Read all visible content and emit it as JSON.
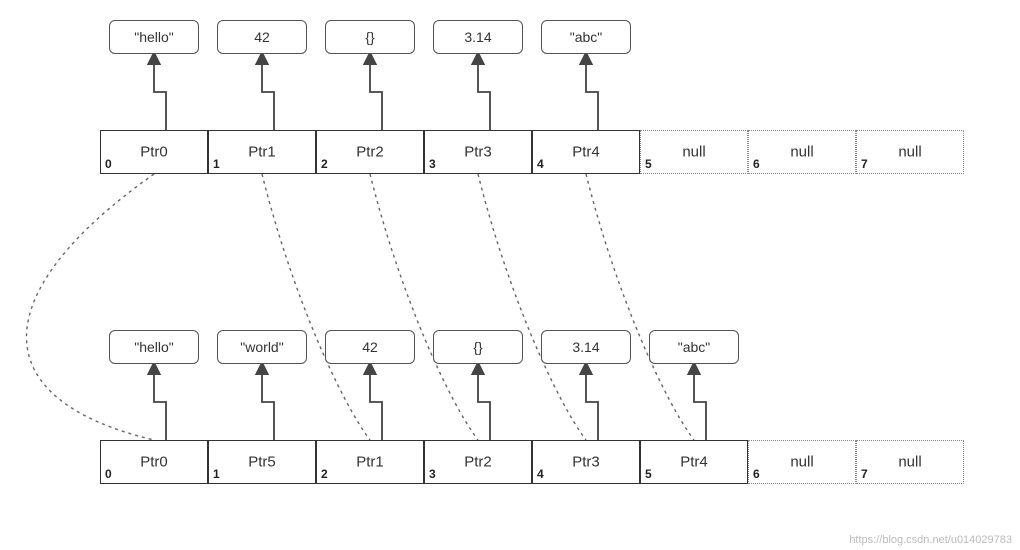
{
  "top": {
    "values": [
      "\"hello\"",
      "42",
      "{}",
      "3.14",
      "\"abc\""
    ],
    "slots": [
      {
        "index": "0",
        "label": "Ptr0",
        "style": "solid"
      },
      {
        "index": "1",
        "label": "Ptr1",
        "style": "solid"
      },
      {
        "index": "2",
        "label": "Ptr2",
        "style": "solid"
      },
      {
        "index": "3",
        "label": "Ptr3",
        "style": "solid"
      },
      {
        "index": "4",
        "label": "Ptr4",
        "style": "solid"
      },
      {
        "index": "5",
        "label": "null",
        "style": "dotted"
      },
      {
        "index": "6",
        "label": "null",
        "style": "dotted"
      },
      {
        "index": "7",
        "label": "null",
        "style": "dotted"
      }
    ]
  },
  "bottom": {
    "values": [
      "\"hello\"",
      "\"world\"",
      "42",
      "{}",
      "3.14",
      "\"abc\""
    ],
    "slots": [
      {
        "index": "0",
        "label": "Ptr0",
        "style": "solid"
      },
      {
        "index": "1",
        "label": "Ptr5",
        "style": "solid"
      },
      {
        "index": "2",
        "label": "Ptr1",
        "style": "solid"
      },
      {
        "index": "3",
        "label": "Ptr2",
        "style": "solid"
      },
      {
        "index": "4",
        "label": "Ptr3",
        "style": "solid"
      },
      {
        "index": "5",
        "label": "Ptr4",
        "style": "solid"
      },
      {
        "index": "6",
        "label": "null",
        "style": "dotted"
      },
      {
        "index": "7",
        "label": "null",
        "style": "dotted"
      }
    ]
  },
  "watermark": "https://blog.csdn.net/u014029783",
  "mappings": [
    {
      "from": 0,
      "to": 0
    },
    {
      "from": 1,
      "to": 2
    },
    {
      "from": 2,
      "to": 3
    },
    {
      "from": 3,
      "to": 4
    },
    {
      "from": 4,
      "to": 5
    }
  ]
}
